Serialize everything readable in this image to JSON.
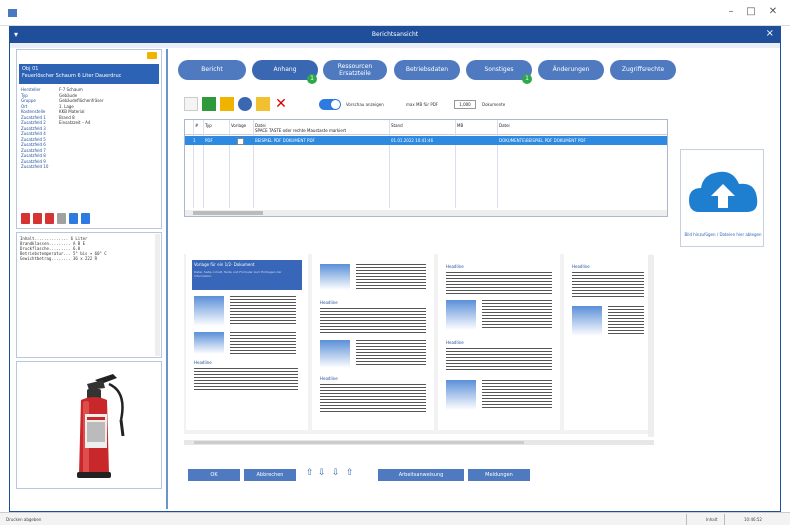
{
  "window": {
    "title": "Berichtsansicht",
    "controls": {
      "minimize": "–",
      "maximize": "□",
      "close": "✕"
    },
    "close_label": "×"
  },
  "left": {
    "object_title_line1": "Obj 01",
    "object_title_line2": "Feuerlöscher Schaum 6 Liter Dauerdruc",
    "properties": [
      {
        "key": "Hersteller",
        "value": "F-7 Schaum"
      },
      {
        "key": "Typ",
        "value": "Gebäude"
      },
      {
        "key": "Gruppe",
        "value": "Gebäudeflächenfräser"
      },
      {
        "key": "Ort",
        "value": "1. Lage"
      },
      {
        "key": "Kostenstelle",
        "value": "KKB Material"
      },
      {
        "key": "Zusatzfeld 1",
        "value": "Brand 8"
      },
      {
        "key": "Zusatzfeld 2",
        "value": "Einsatzzeit – A4"
      },
      {
        "key": "Zusatzfeld 3",
        "value": ""
      },
      {
        "key": "Zusatzfeld 4",
        "value": ""
      },
      {
        "key": "Zusatzfeld 5",
        "value": ""
      },
      {
        "key": "Zusatzfeld 6",
        "value": ""
      },
      {
        "key": "Zusatzfeld 7",
        "value": ""
      },
      {
        "key": "Zusatzfeld 8",
        "value": ""
      },
      {
        "key": "Zusatzfeld 9",
        "value": ""
      },
      {
        "key": "Zusatzfeld 10",
        "value": ""
      }
    ],
    "notes": [
      "Inhalt.............. 6 Liter",
      "Brandklassen......... A B E",
      "Druckflasche......... 6.8",
      "Betriebstemperatur... 5° bis + 60° C",
      "Gewichtbetrag........ 36 x 222 R"
    ],
    "color_buttons": [
      "#d63333",
      "#d63333",
      "#d63333",
      "#a1a1a1",
      "#2d7be0",
      "#2d7be0"
    ]
  },
  "tabs": [
    {
      "label": "Bericht"
    },
    {
      "label": "Anhang",
      "badge": "1"
    },
    {
      "label_line1": "Ressourcen",
      "label_line2": "Ersatzteile"
    },
    {
      "label": "Betriebsdaten"
    },
    {
      "label": "Sonstiges",
      "badge": "1"
    },
    {
      "label": "Änderungen"
    },
    {
      "label": "Zugriffsrechte"
    }
  ],
  "toolbar": {
    "toggle_label": "Vorschau anzeigen",
    "maxmb_label": "max MB für PDF",
    "maxmb_value": "1,000",
    "docs_label": "Dokumente"
  },
  "grid": {
    "columns": [
      "#",
      "Typ",
      "Vorlage",
      "Datei",
      "Stand",
      "MB",
      "Datei"
    ],
    "column_note": "SPACE TASTE oder rechte Maustaste markiert",
    "rows": [
      {
        "num": "1",
        "typ": "PDF",
        "datei": "BEISPIEL PDF DOKUMENT PDF",
        "stand": "01.01.2022 10:41:46",
        "mb": "",
        "pfad": "DOKUMENTE\\BEISPIEL PDF DOKUMENT PDF"
      }
    ]
  },
  "upload": {
    "label": "Bild hinzufügen / Dateien hier ablegen"
  },
  "preview": {
    "p1_title": "Vorlage für ein 1/2- Dokument",
    "p1_sub": "Datei, Seite, Inhalt, Texte und Formular zum Eintragen der Information",
    "headline": "Headline"
  },
  "buttons": {
    "ok": "OK",
    "cancel": "Abbrechen",
    "io_icons": [
      "⇧",
      "⇩",
      "⇩",
      "⇧"
    ],
    "sign": "Arbeitsanweisung",
    "notes": "Meldungen"
  },
  "status": {
    "left": "Drucken abgeben",
    "mid": "Inhalt",
    "right": "10:46:52"
  }
}
